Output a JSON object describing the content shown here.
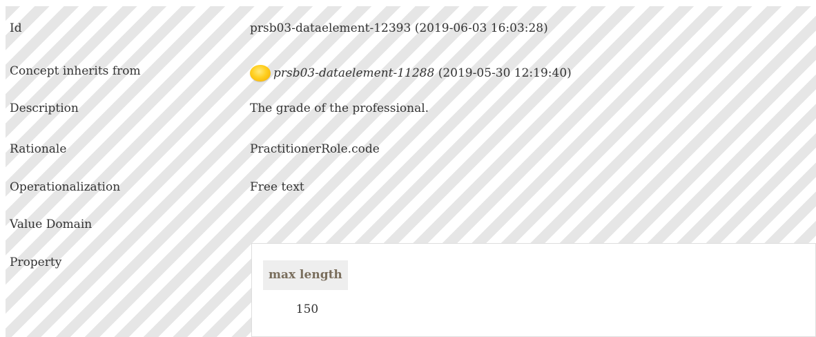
{
  "fields": {
    "id": {
      "label": "Id",
      "value": "prsb03-dataelement-12393 (2019-06-03 16:03:28)"
    },
    "inherits": {
      "label": "Concept inherits from",
      "link": "prsb03-dataelement-11288",
      "suffix": " (2019-05-30 12:19:40)",
      "status_color": "#ffcf1f"
    },
    "description": {
      "label": "Description",
      "value": "The grade of the professional."
    },
    "rationale": {
      "label": "Rationale",
      "value": "PractitionerRole.code"
    },
    "operationalization": {
      "label": "Operationalization",
      "value": "Free text"
    },
    "value_domain": {
      "label": "Value Domain"
    },
    "property": {
      "label": "Property",
      "header": "max length",
      "value": "150"
    }
  }
}
